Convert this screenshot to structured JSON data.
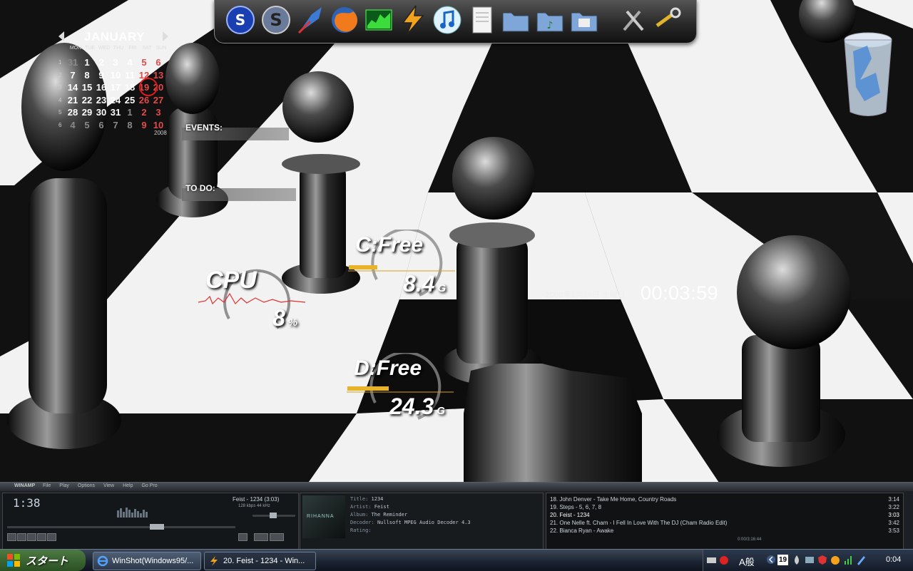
{
  "dock": {
    "icons": [
      "skype-icon",
      "s-app-icon",
      "feather-icon",
      "firefox-icon",
      "system-monitor-icon",
      "winamp-icon",
      "itunes-icon",
      "notepad-icon",
      "folder-icon",
      "music-folder-icon",
      "pictures-folder-icon",
      "tools-icon",
      "settings-icon"
    ]
  },
  "calendar": {
    "month": "JANUARY",
    "weekdays": [
      "MON",
      "TUE",
      "WED",
      "THU",
      "FRI",
      "SAT",
      "SUN"
    ],
    "week_numbers": [
      "1",
      "2",
      "3",
      "4",
      "5",
      "6"
    ],
    "weeks": [
      [
        "31",
        "1",
        "2",
        "3",
        "4",
        "5",
        "6"
      ],
      [
        "7",
        "8",
        "9",
        "10",
        "11",
        "12",
        "13"
      ],
      [
        "14",
        "15",
        "16",
        "17",
        "18",
        "19",
        "20"
      ],
      [
        "21",
        "22",
        "23",
        "24",
        "25",
        "26",
        "27"
      ],
      [
        "28",
        "29",
        "30",
        "31",
        "1",
        "2",
        "3"
      ],
      [
        "4",
        "5",
        "6",
        "7",
        "8",
        "9",
        "10"
      ]
    ],
    "today": "19",
    "year": "2008"
  },
  "events": {
    "label": "EVENTS:"
  },
  "todo": {
    "label": "TO DO:"
  },
  "meters": {
    "cpu": {
      "title": "CPU",
      "value": "8",
      "unit": "%",
      "percent": 8
    },
    "c_drive": {
      "title": "C:Free",
      "value": "8.4",
      "unit": "G"
    },
    "d_drive": {
      "title": "D:Free",
      "value": "24.3",
      "unit": "G"
    }
  },
  "clock": {
    "date": "2008年1月19日 土曜日",
    "time": "00:03:59"
  },
  "winamp": {
    "brand": "WINAMP",
    "menu": [
      "File",
      "Play",
      "Options",
      "View",
      "Help",
      "Go Pro"
    ],
    "elapsed": "1:38",
    "track": "Feist - 1234 (3:03)",
    "meta": "128 kbps 44 kHz",
    "album_art_text": "RIHANNA",
    "fields": [
      {
        "label": "Title:",
        "value": "1234"
      },
      {
        "label": "Artist:",
        "value": "Feist"
      },
      {
        "label": "Album:",
        "value": "The Reminder"
      },
      {
        "label": "Decoder:",
        "value": "Nullsoft MPEG Audio Decoder 4.3"
      },
      {
        "label": "Rating:",
        "value": ""
      }
    ],
    "playlist": [
      {
        "title": "18. John Denver - Take Me Home, Country Roads",
        "time": "3:14"
      },
      {
        "title": "19. Steps - 5, 6, 7, 8",
        "time": "3:22"
      },
      {
        "title": "20. Feist - 1234",
        "time": "3:03"
      },
      {
        "title": "21. One Nelle ft. Cham - I Fell In Love With The DJ (Cham Radio Edit)",
        "time": "3:42"
      },
      {
        "title": "22. Bianca Ryan - Awake",
        "time": "3:53"
      }
    ],
    "playlist_counter": "0:00/3:16:44"
  },
  "taskbar": {
    "start_label": "スタート",
    "tasks": [
      {
        "label": "WinShot(Windows95/...",
        "active": false
      },
      {
        "label": "20. Feist - 1234 - Win...",
        "active": true
      }
    ],
    "ime": "A般",
    "clock": "0:04",
    "calendar_badge": "19"
  }
}
